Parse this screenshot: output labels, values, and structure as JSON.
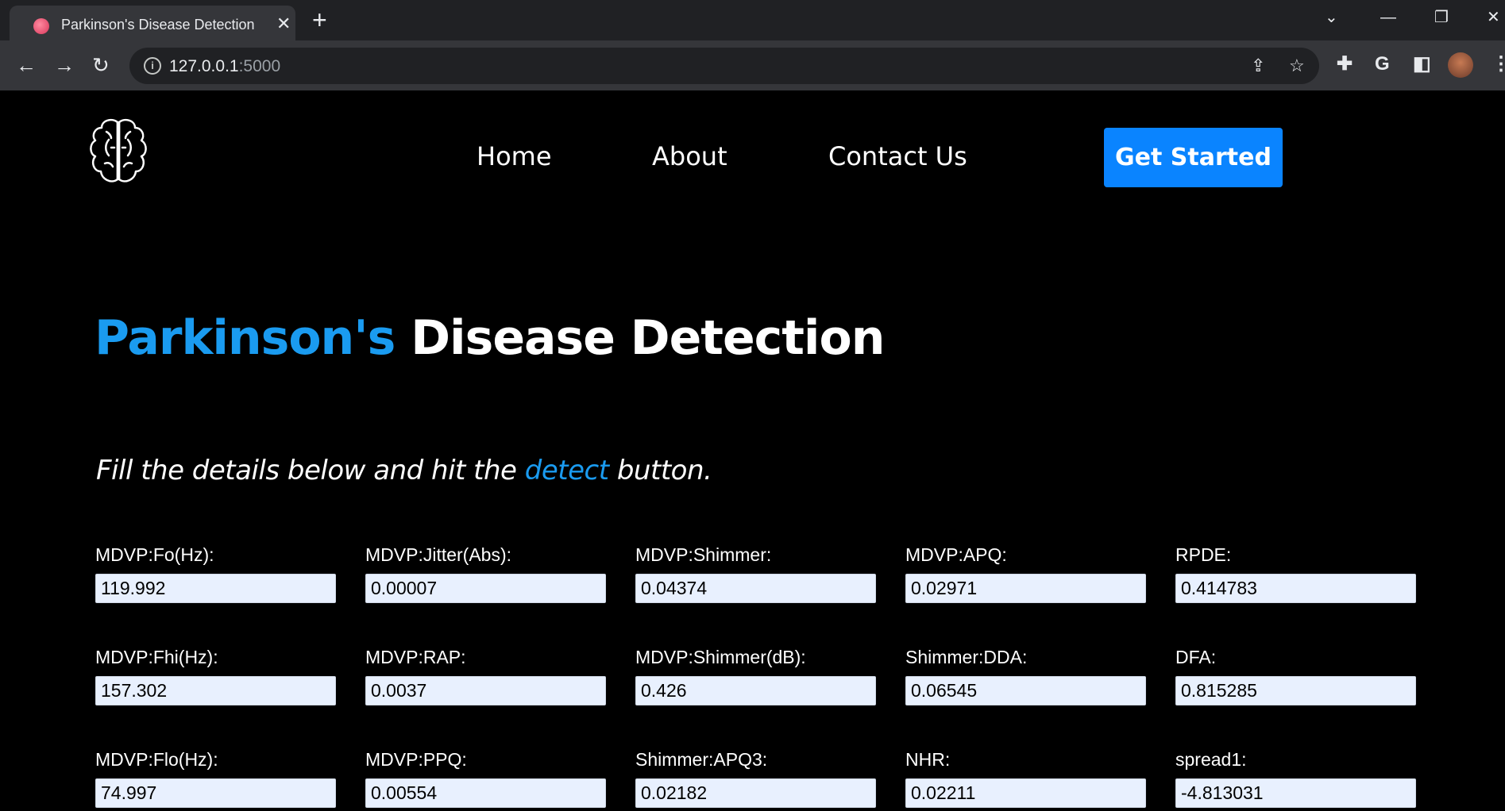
{
  "browser": {
    "tab_title": "Parkinson's Disease Detection",
    "url_host": "127.0.0.1",
    "url_port": ":5000"
  },
  "nav": {
    "home": "Home",
    "about": "About",
    "contact": "Contact Us",
    "cta": "Get Started"
  },
  "hero": {
    "title_accent": "Parkinson's",
    "title_rest": " Disease Detection"
  },
  "instructions": {
    "prefix": "Fill the details below and hit the ",
    "accent": "detect",
    "suffix": " button."
  },
  "fields": [
    {
      "label": "MDVP:Fo(Hz):",
      "value": "119.992"
    },
    {
      "label": "MDVP:Jitter(Abs):",
      "value": "0.00007"
    },
    {
      "label": "MDVP:Shimmer:",
      "value": "0.04374"
    },
    {
      "label": "MDVP:APQ:",
      "value": "0.02971"
    },
    {
      "label": "RPDE:",
      "value": "0.414783"
    },
    {
      "label": "MDVP:Fhi(Hz):",
      "value": "157.302"
    },
    {
      "label": "MDVP:RAP:",
      "value": "0.0037"
    },
    {
      "label": "MDVP:Shimmer(dB):",
      "value": "0.426"
    },
    {
      "label": "Shimmer:DDA:",
      "value": "0.06545"
    },
    {
      "label": "DFA:",
      "value": "0.815285"
    },
    {
      "label": "MDVP:Flo(Hz):",
      "value": "74.997"
    },
    {
      "label": "MDVP:PPQ:",
      "value": "0.00554"
    },
    {
      "label": "Shimmer:APQ3:",
      "value": "0.02182"
    },
    {
      "label": "NHR:",
      "value": "0.02211"
    },
    {
      "label": "spread1:",
      "value": "-4.813031"
    }
  ],
  "colors": {
    "accent": "#1a9bf0",
    "cta_bg": "#0a84ff",
    "input_bg": "#e8f0fe",
    "page_bg": "#000000"
  }
}
